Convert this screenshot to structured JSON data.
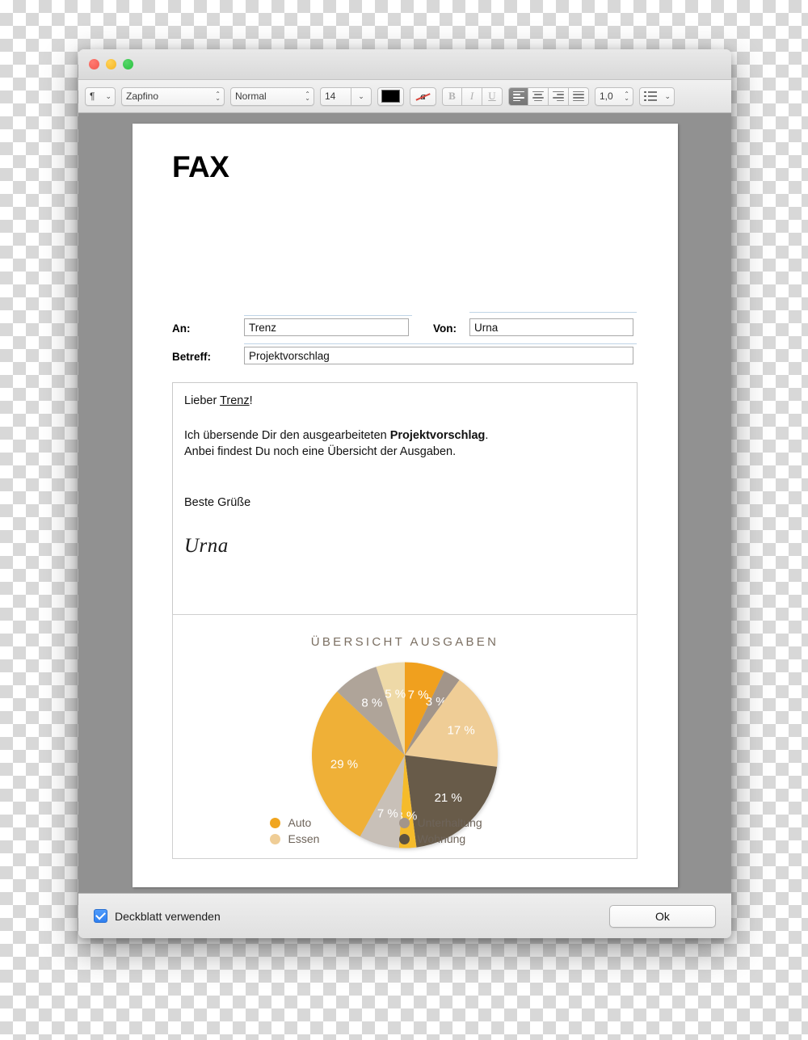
{
  "window": {
    "traffic_lights": [
      "close",
      "minimize",
      "maximize"
    ]
  },
  "toolbar": {
    "paragraph_button": "¶",
    "font_family": "Zapfino",
    "font_style": "Normal",
    "font_size": "14",
    "text_color": "#000000",
    "highlight_glyph": "a",
    "bold_label": "B",
    "italic_label": "I",
    "underline_label": "U",
    "line_spacing": "1,0",
    "alignment_selected": "left"
  },
  "document": {
    "title": "FAX",
    "fields": [
      {
        "label": "An:",
        "value": "Trenz"
      },
      {
        "label": "Von:",
        "value": "Urna"
      },
      {
        "label": "Betreff:",
        "value": "Projektvorschlag"
      }
    ],
    "body": {
      "greeting_prefix": "Lieber ",
      "greeting_name": "Trenz",
      "greeting_suffix": "!",
      "line1_prefix": "Ich übersende Dir den ausgearbeiteten ",
      "line1_bold": "Projektvorschlag",
      "line1_suffix": ".",
      "line2": "Anbei findest Du noch eine Übersicht der Ausgaben.",
      "closing": "Beste Grüße",
      "signature": "Urna"
    }
  },
  "chart_data": {
    "type": "pie",
    "title": "ÜBERSICHT AUSGABEN",
    "unit": "%",
    "start_angle_deg": 0,
    "direction": "clockwise",
    "slices": [
      {
        "label": "7 %",
        "value": 7,
        "color": "#F0A01E",
        "category": "Auto"
      },
      {
        "label": "3 %",
        "value": 3,
        "color": "#A2958A",
        "category": "Unterhaltung"
      },
      {
        "label": "17 %",
        "value": 17,
        "color": "#EFCD96",
        "category": "Essen"
      },
      {
        "label": "21 %",
        "value": 21,
        "color": "#685B49",
        "category": "Wohnung"
      },
      {
        "label": "3 %",
        "value": 3,
        "color": "#F5BB2B",
        "category": "Auto"
      },
      {
        "label": "7 %",
        "value": 7,
        "color": "#C8C0B8",
        "category": "Unterhaltung"
      },
      {
        "label": "29 %",
        "value": 29,
        "color": "#EFB037",
        "category": "Auto"
      },
      {
        "label": "8 %",
        "value": 8,
        "color": "#AFA499",
        "category": "Unterhaltung"
      },
      {
        "label": "5 %",
        "value": 5,
        "color": "#EED9A7",
        "category": "Essen"
      }
    ],
    "legend_position": "bottom",
    "legend": [
      {
        "label": "Auto",
        "color": "#F0A51F"
      },
      {
        "label": "Unterhaltung",
        "color": "#A2958A"
      },
      {
        "label": "Essen",
        "color": "#EFCD96"
      },
      {
        "label": "Wohnung",
        "color": "#5E523F"
      }
    ]
  },
  "footer": {
    "checkbox_label": "Deckblatt verwenden",
    "checkbox_checked": true,
    "ok_label": "Ok"
  }
}
